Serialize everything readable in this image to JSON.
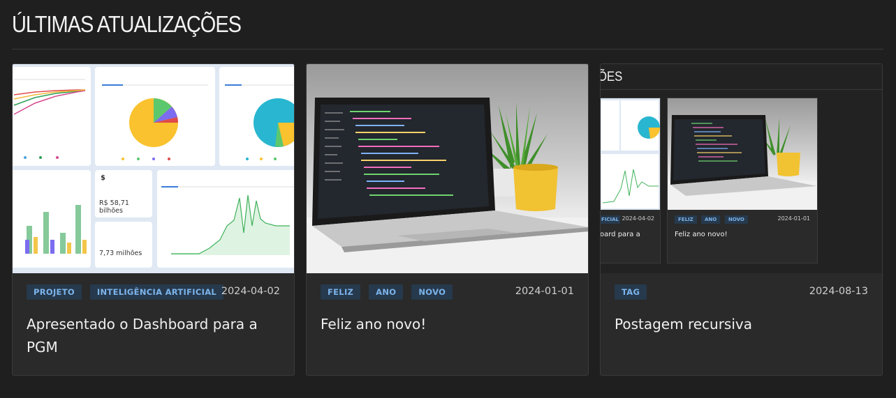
{
  "section": {
    "title": "ÚLTIMAS ATUALIZAÇÕES"
  },
  "cards": [
    {
      "tags": [
        "PROJETO",
        "INTELIGÊNCIA ARTIFICIAL"
      ],
      "date": "2024-04-02",
      "title": "Apresentado o Dashboard para a PGM",
      "image": {
        "kpi1_icon": "$",
        "kpi1_value": "R$ 58,71 bilhões",
        "kpi2_value": "7,73 milhões"
      }
    },
    {
      "tags": [
        "FELIZ",
        "ANO",
        "NOVO"
      ],
      "date": "2024-01-01",
      "title": "Feliz ano novo!"
    },
    {
      "tags": [
        "TAG"
      ],
      "date": "2024-08-13",
      "title": "Postagem recursiva",
      "image": {
        "heading_fragment": "ÕES",
        "card_a_tag": "FICIAL",
        "card_a_date": "2024-04-02",
        "card_a_title": "oard para a",
        "card_b_tags": [
          "FELIZ",
          "ANO",
          "NOVO"
        ],
        "card_b_date": "2024-01-01",
        "card_b_title": "Feliz ano novo!"
      }
    }
  ],
  "colors": {
    "background": "#1f1f1f",
    "card": "#2a2a2a",
    "tag_bg": "#26394d",
    "tag_text": "#7db4ea"
  }
}
